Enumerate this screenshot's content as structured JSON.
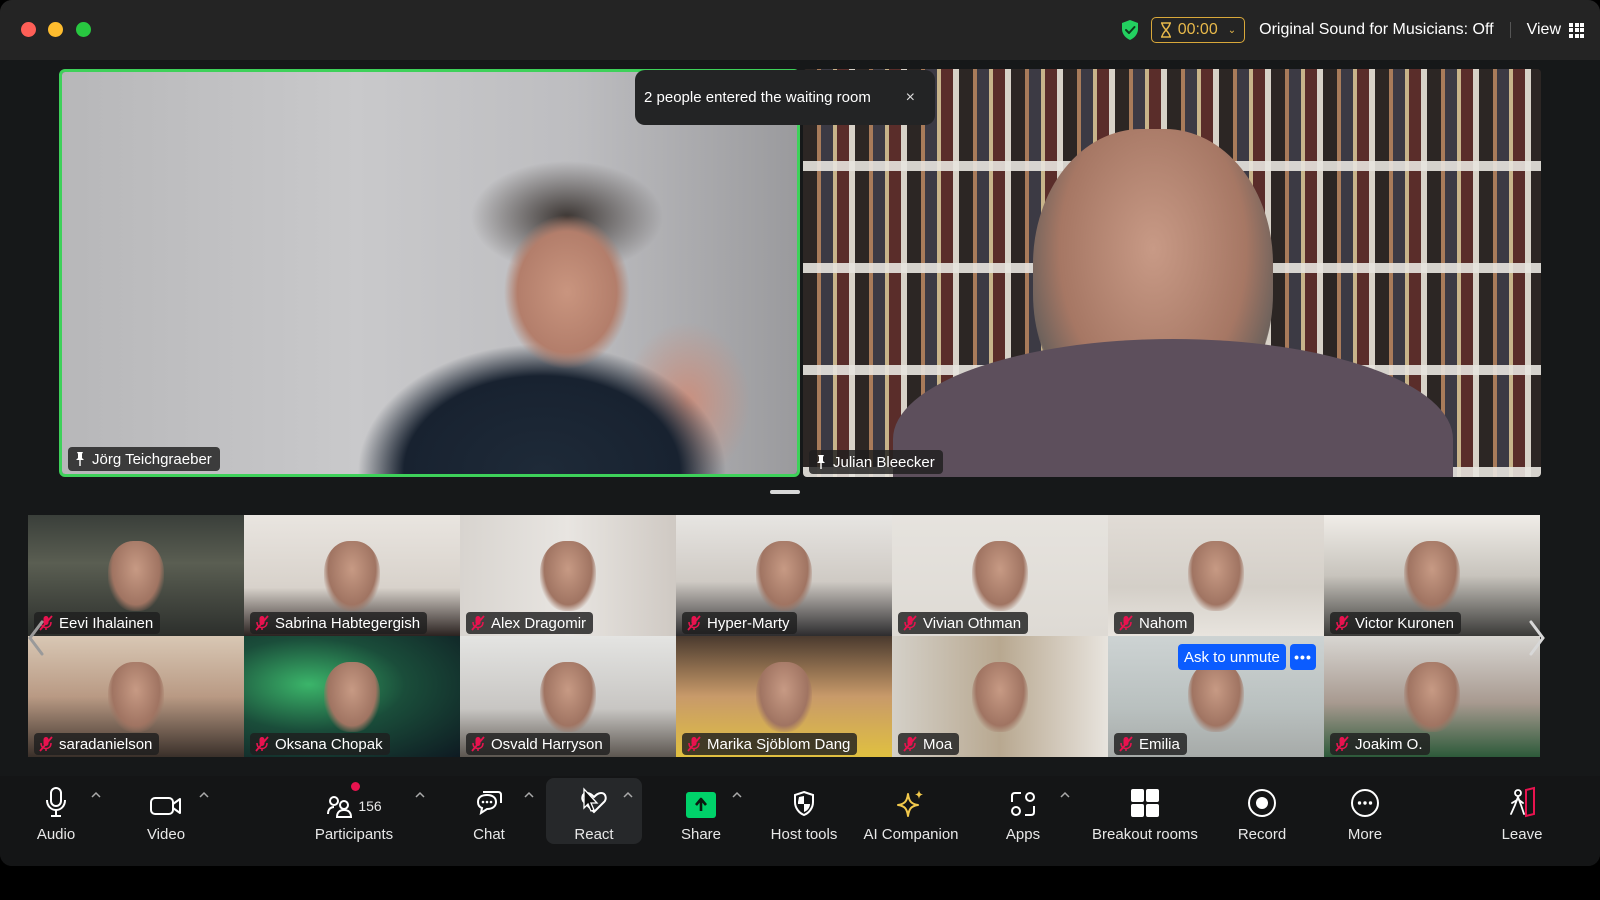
{
  "titlebar": {
    "timer": "00:00",
    "original_sound": "Original Sound for Musicians: Off",
    "view_label": "View"
  },
  "colors": {
    "active_speaker_border": "#3ed15a",
    "share_green": "#00d26a",
    "timer_gold": "#e7b84a",
    "ask_unmute_blue": "#0b5cff",
    "notification_red": "#e8134f",
    "security_green": "#23d160"
  },
  "notification": {
    "text": "2 people entered the waiting room",
    "close_glyph": "×"
  },
  "speakers": [
    {
      "name": "Jörg Teichgraeber",
      "pinned": true,
      "active": true
    },
    {
      "name": "Julian Bleecker",
      "pinned": true,
      "active": false
    }
  ],
  "gallery": {
    "row1": [
      {
        "name": "Eevi Ihalainen",
        "muted": true
      },
      {
        "name": "Sabrina Habtegergish",
        "muted": true
      },
      {
        "name": "Alex Dragomir",
        "muted": true
      },
      {
        "name": "Hyper-Marty",
        "muted": true
      },
      {
        "name": "Vivian Othman",
        "muted": true
      },
      {
        "name": "Nahom",
        "muted": true
      },
      {
        "name": "Victor Kuronen",
        "muted": true
      }
    ],
    "row2": [
      {
        "name": "saradanielson",
        "muted": true
      },
      {
        "name": "Oksana Chopak",
        "muted": true
      },
      {
        "name": "Osvald Harryson",
        "muted": true
      },
      {
        "name": "Marika Sjöblom Dang",
        "muted": true
      },
      {
        "name": "Moa",
        "muted": true
      },
      {
        "name": "Emilia",
        "muted": true
      },
      {
        "name": "Joakim O.",
        "muted": true
      }
    ],
    "ask_to_unmute": "Ask to unmute",
    "more_glyph": "•••"
  },
  "toolbar": {
    "audio": "Audio",
    "video": "Video",
    "participants": "Participants",
    "participant_count": "156",
    "chat": "Chat",
    "react": "React",
    "share": "Share",
    "host_tools": "Host tools",
    "ai_companion": "AI Companion",
    "apps": "Apps",
    "breakout_rooms": "Breakout rooms",
    "record": "Record",
    "more": "More",
    "leave": "Leave"
  }
}
